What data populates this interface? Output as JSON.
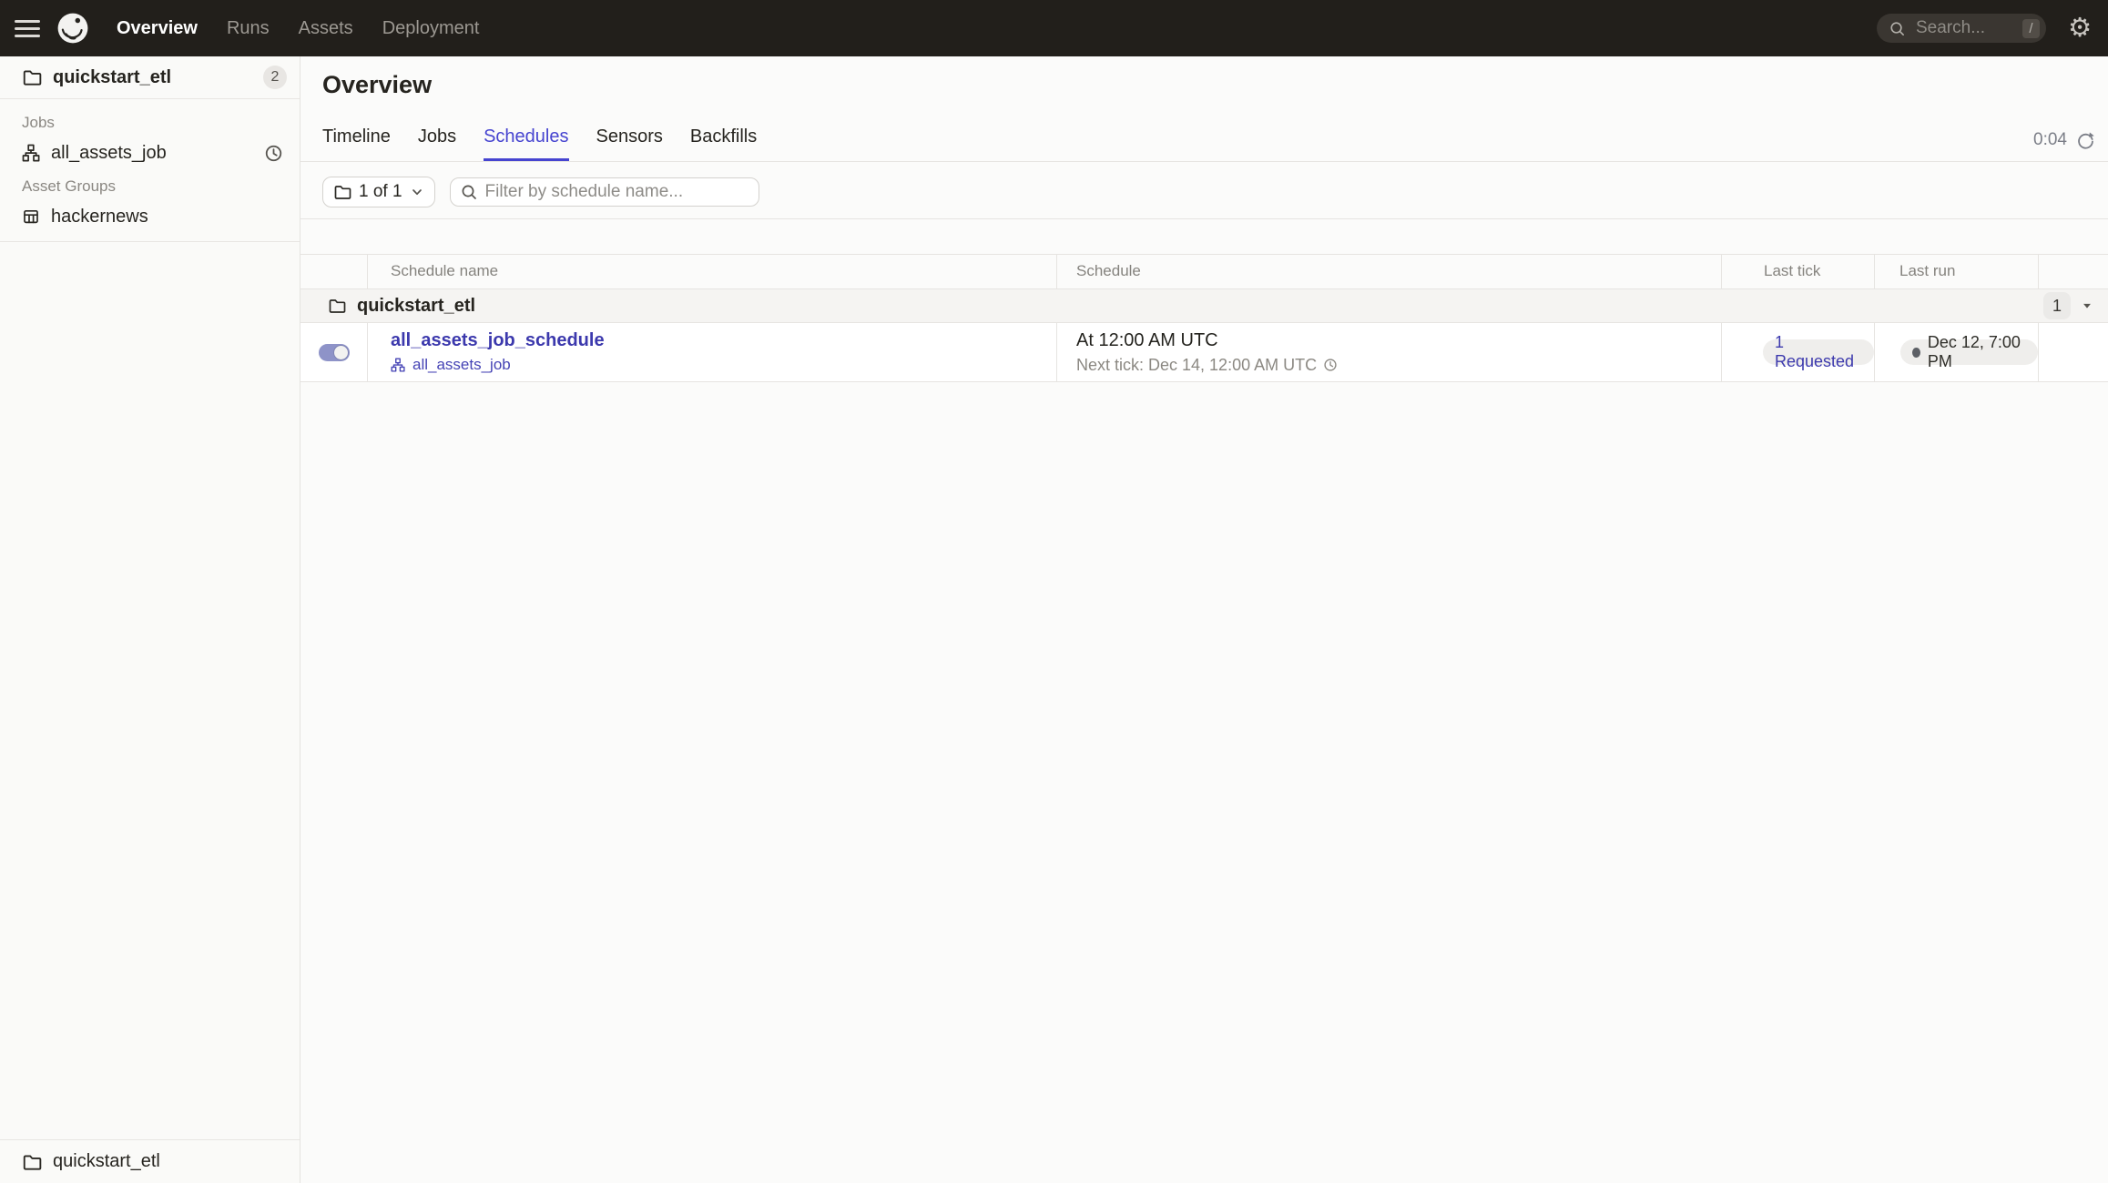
{
  "topbar": {
    "nav": [
      "Overview",
      "Runs",
      "Assets",
      "Deployment"
    ],
    "search": {
      "placeholder": "Search...",
      "shortcut": "/"
    }
  },
  "sidebar": {
    "header": {
      "label": "quickstart_etl",
      "badge": "2"
    },
    "jobs_label": "Jobs",
    "jobs": [
      {
        "label": "all_assets_job"
      }
    ],
    "asset_groups_label": "Asset Groups",
    "asset_groups": [
      {
        "label": "hackernews"
      }
    ],
    "footer": {
      "label": "quickstart_etl"
    }
  },
  "main": {
    "title": "Overview",
    "tabs": [
      "Timeline",
      "Jobs",
      "Schedules",
      "Sensors",
      "Backfills"
    ],
    "active_tab": "Schedules",
    "refresh_elapsed": "0:04",
    "filters": {
      "repo_selector": "1 of 1",
      "search_placeholder": "Filter by schedule name..."
    },
    "table": {
      "columns": [
        "Schedule name",
        "Schedule",
        "Last tick",
        "Last run"
      ],
      "group": {
        "name": "quickstart_etl",
        "count": "1"
      },
      "rows": [
        {
          "enabled": true,
          "schedule_name": "all_assets_job_schedule",
          "job": "all_assets_job",
          "cron_human": "At 12:00 AM UTC",
          "next_tick": "Next tick: Dec 14, 12:00 AM UTC",
          "last_tick": "1 Requested",
          "last_run": "Dec 12, 7:00 PM"
        }
      ]
    }
  },
  "colors": {
    "accent": "#4644d0",
    "link": "#3c39ad",
    "topbar_bg": "#221f1b",
    "toggle_on": "#8e93c8",
    "run_status_dot": "#5d6066"
  }
}
